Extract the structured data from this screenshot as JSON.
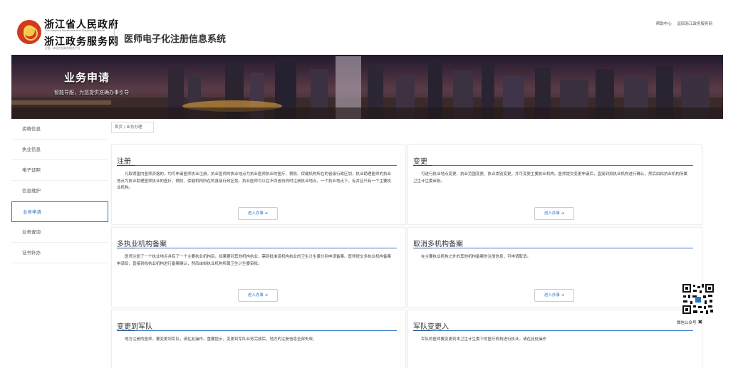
{
  "header": {
    "gov_name": "浙江省人民政府",
    "gov_name_en": "The People's Government of Zhejiang Province",
    "portal_name": "浙江政务服务网",
    "portal_tagline": "全国一体化在线政务服务平台",
    "system_title": "医师电子化注册信息系统",
    "links": [
      "帮助中心",
      "返回浙江政务服务网"
    ]
  },
  "banner": {
    "title": "业务申请",
    "subtitle": "智能导服，为您提供准确办事引导"
  },
  "sidebar": {
    "items": [
      {
        "label": "资格信息"
      },
      {
        "label": "执业信息"
      },
      {
        "label": "电子证照"
      },
      {
        "label": "信息维护"
      },
      {
        "label": "业务申请",
        "active": true
      },
      {
        "label": "业务查询"
      },
      {
        "label": "证书补办"
      }
    ]
  },
  "breadcrumb": {
    "home": "首页",
    "separator": "/",
    "current": "业务办理"
  },
  "cards": [
    {
      "title": "注册",
      "desc": "凡取得国内医师资格的，均可申请医师执业注册。执业医师的执业地点为执业医师执业的医疗、预防、保健机构所在的省级行政区划，执业助理医师的执业地点为执业助理医师执业的医疗、预防、保健机构所在的县级行政区划。执业医师可以在不同省份同时注册执业地点，一个执业地点下，有并且只有一个主要执业机构。",
      "button": "进入办事 ➔"
    },
    {
      "title": "变更",
      "desc": "可进行执业地点变更、执业范围变更、执业类别变更，并可变更主要执业机构。医师提交变更申请后，直接到拟执业机构进行确认，然后由拟执业机构所属卫生计生委审批。",
      "button": "进入办事 ➔"
    },
    {
      "title": "多执业机构备案",
      "desc": "医师注册了一个执业地点并有了一个主要执业机构后，如果要到其他机构执业，需到批准该机构执业的卫生计生委分别申请备案。医师提交多执业机构备案申请后，直接到拟执业机构进行备案确认，然后由拟执业机构所属卫生计生委审批。",
      "button": "进入办事 ➔"
    },
    {
      "title": "取消多机构备案",
      "desc": "在主要执业机构之外的其他机构备案的注册信息，可申请取消。",
      "button": "进入办事 ➔"
    },
    {
      "title": "变更到军队",
      "desc": "地方注册的医师，要变更到军队，请在此操作。重要提示，变更到军队业务完成后，地方的注册信息全部失效。",
      "button": ""
    },
    {
      "title": "军队变更入",
      "desc": "军队的医师要变更到本卫生计生委下的医疗机构进行执业，请在此处操作",
      "button": ""
    }
  ],
  "qr": {
    "label": "微信公众号",
    "close": "✖"
  }
}
